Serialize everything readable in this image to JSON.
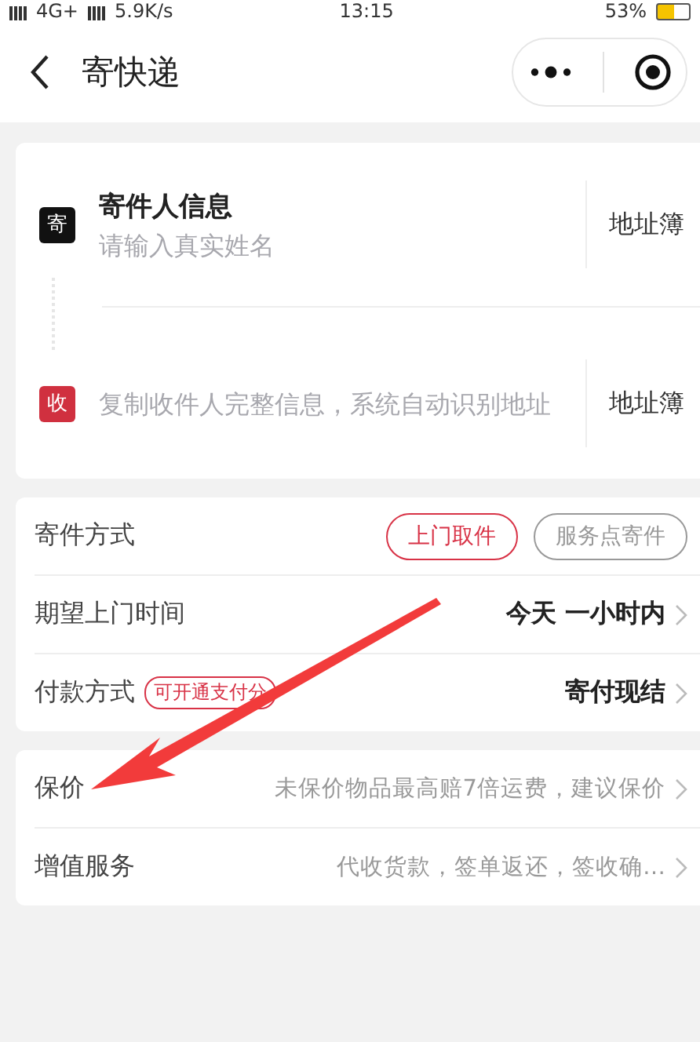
{
  "status_bar": {
    "network": "4G+",
    "speed": "5.9K/s",
    "time": "13:15",
    "battery": "53%"
  },
  "nav": {
    "title": "寄快递"
  },
  "contacts": [
    {
      "kind": "sender",
      "badge": "寄",
      "title": "寄件人信息",
      "placeholder": "请输入真实姓名",
      "action": "地址簿"
    },
    {
      "kind": "receiver",
      "badge": "收",
      "placeholder": "复制收件人完整信息，系统自动识别地址",
      "action": "地址簿"
    }
  ],
  "shipping": {
    "label": "寄件方式",
    "options": [
      {
        "label": "上门取件",
        "selected": true
      },
      {
        "label": "服务点寄件",
        "selected": false
      }
    ]
  },
  "rows": [
    {
      "label": "期望上门时间",
      "value": "今天 一小时内"
    },
    {
      "label": "付款方式",
      "tag": "可开通支付分",
      "value": "寄付现结"
    }
  ],
  "services": [
    {
      "label": "保价",
      "value": "未保价物品最高赔7倍运费，建议保价"
    },
    {
      "label": "增值服务",
      "value": "代收货款，签单返还，签收确…"
    }
  ],
  "annotation": {
    "kind": "arrow"
  }
}
